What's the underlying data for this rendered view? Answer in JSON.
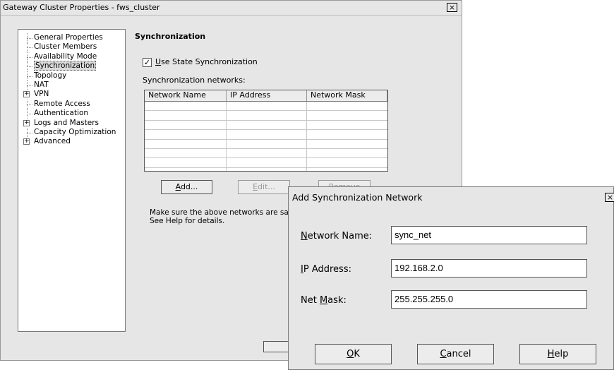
{
  "main_window": {
    "title": "Gateway Cluster Properties - fws_cluster",
    "close_glyph": "×",
    "tree": [
      {
        "label": "General Properties",
        "expandable": false,
        "selected": false
      },
      {
        "label": "Cluster Members",
        "expandable": false,
        "selected": false
      },
      {
        "label": "Availability Mode",
        "expandable": false,
        "selected": false
      },
      {
        "label": "Synchronization",
        "expandable": false,
        "selected": true
      },
      {
        "label": "Topology",
        "expandable": false,
        "selected": false
      },
      {
        "label": "NAT",
        "expandable": false,
        "selected": false
      },
      {
        "label": "VPN",
        "expandable": true,
        "selected": false
      },
      {
        "label": "Remote Access",
        "expandable": false,
        "selected": false
      },
      {
        "label": "Authentication",
        "expandable": false,
        "selected": false
      },
      {
        "label": "Logs and Masters",
        "expandable": true,
        "selected": false
      },
      {
        "label": "Capacity Optimization",
        "expandable": false,
        "selected": false
      },
      {
        "label": "Advanced",
        "expandable": true,
        "selected": false
      }
    ],
    "section_title": "Synchronization",
    "use_state_sync": {
      "checked": true,
      "check_glyph": "✓",
      "label_mnemonic": "U",
      "label_rest": "se State Synchronization"
    },
    "networks_label": "Synchronization networks:",
    "table": {
      "columns": [
        "Network Name",
        "IP Address",
        "Network Mask"
      ],
      "rows": []
    },
    "buttons": {
      "add_mnemonic": "A",
      "add_rest": "dd...",
      "edit_mnemonic": "E",
      "edit_rest": "dit...",
      "remove": "Remove"
    },
    "note_line1": "Make sure the above networks are safe.",
    "note_line2": "See Help for details."
  },
  "dialog": {
    "title": "Add Synchronization Network",
    "close_glyph": "×",
    "fields": {
      "network_name": {
        "mnemonic": "N",
        "rest": "etwork Name:",
        "value": "sync_net"
      },
      "ip_address": {
        "mnemonic": "I",
        "rest": "P Address:",
        "value": "192.168.2.0"
      },
      "net_mask": {
        "prefix": "Net ",
        "mnemonic": "M",
        "rest": "ask:",
        "value": "255.255.255.0"
      }
    },
    "buttons": {
      "ok_mnemonic": "O",
      "ok_rest": "K",
      "cancel_mnemonic": "C",
      "cancel_rest": "ancel",
      "help_mnemonic": "H",
      "help_rest": "elp"
    }
  }
}
